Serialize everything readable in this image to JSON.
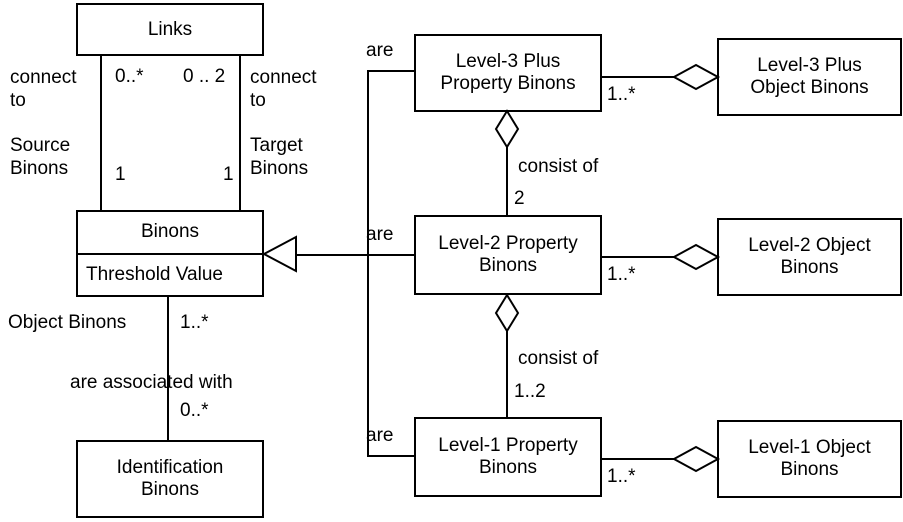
{
  "diagram": {
    "title": "Binon class diagram",
    "stroke_color": "#000000",
    "background_color": "#ffffff",
    "classes": {
      "links": {
        "name": "Links"
      },
      "binons": {
        "name": "Binons",
        "attribute": "Threshold Value"
      },
      "identification_binons": {
        "name": "Identification\nBinons"
      },
      "level3_property": {
        "name": "Level-3 Plus\nProperty Binons"
      },
      "level3_object": {
        "name": "Level-3 Plus\nObject Binons"
      },
      "level2_property": {
        "name": "Level-2 Property\nBinons"
      },
      "level2_object": {
        "name": "Level-2 Object\nBinons"
      },
      "level1_property": {
        "name": "Level-1 Property\nBinons"
      },
      "level1_object": {
        "name": "Level-1 Object\nBinons"
      }
    },
    "labels": {
      "connect_to_source": "connect\nto\n\nSource\nBinons",
      "connect_to_target": "connect\nto\n\nTarget\nBinons",
      "object_binons": "Object Binons",
      "are_associated_with": "are associated with",
      "are_level3": "are",
      "are_level2": "are",
      "are_level1": "are",
      "consist_of_level2": "consist of",
      "consist_of_level1": "consist of"
    },
    "multiplicities": {
      "links_source_top": "0..*",
      "links_target_top": "0 .. 2",
      "links_source_bottom": "1",
      "links_target_bottom": "1",
      "binons_to_identification_top": "1..*",
      "binons_to_identification_bottom": "0..*",
      "level3_consist_of": "2",
      "level1_consist_of": "1..2",
      "level3_object": "1..*",
      "level2_object": "1..*",
      "level1_object": "1..*"
    }
  }
}
